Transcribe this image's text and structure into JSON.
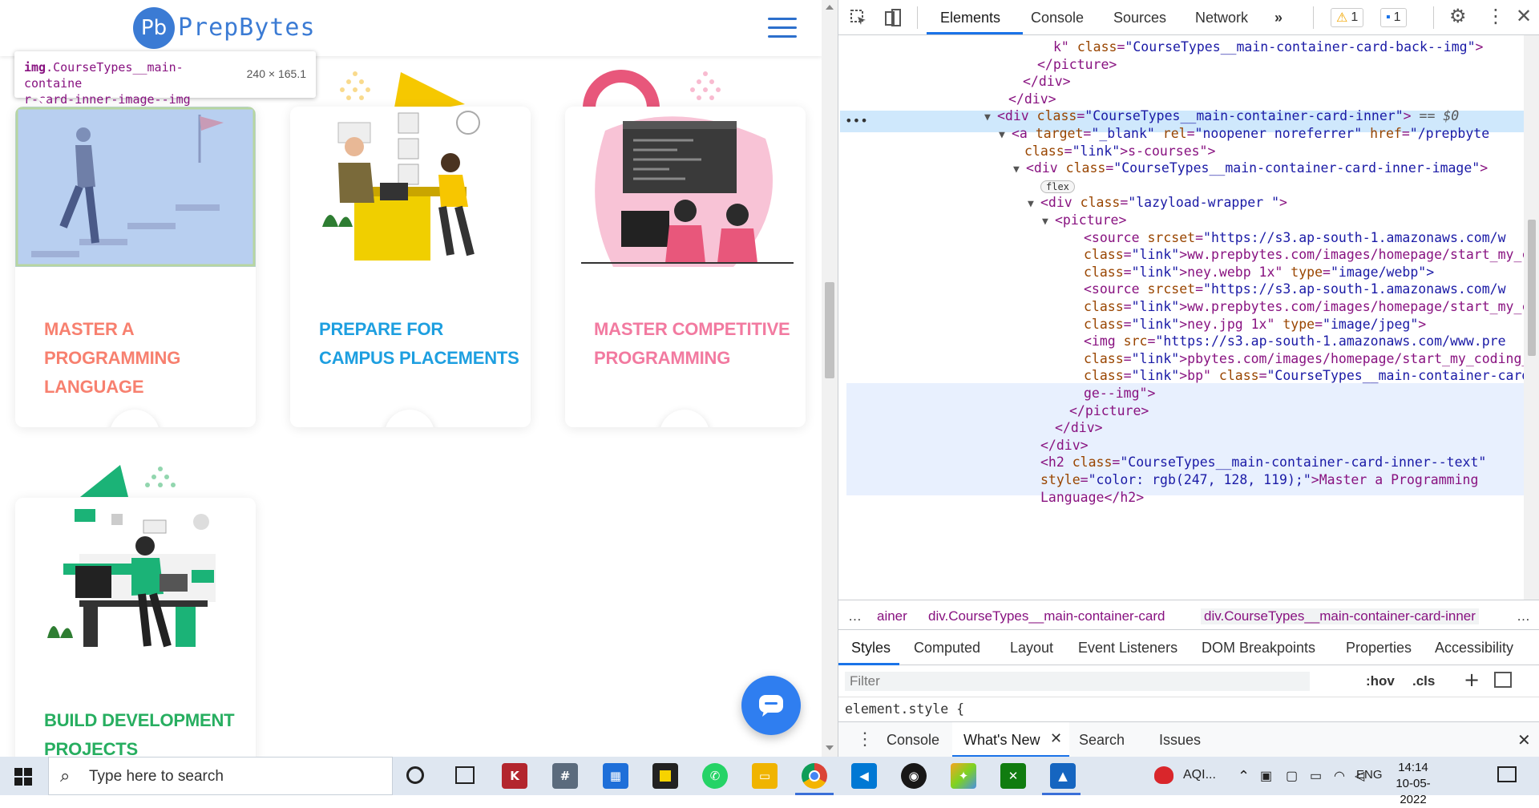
{
  "site": {
    "logo_mark": "Pb",
    "logo_text": "PrepBytes",
    "cards": [
      {
        "title": "MASTER A PROGRAMMING LANGUAGE",
        "color": "#f7806f"
      },
      {
        "title": "PREPARE FOR CAMPUS PLACEMENTS",
        "color": "#1e9fe0"
      },
      {
        "title": "MASTER COMPETITIVE PROGRAMMING",
        "color": "#f27aa0"
      },
      {
        "title": "BUILD DEVELOPMENT PROJECTS",
        "color": "#27ae60"
      }
    ],
    "arrow_glyph": "→"
  },
  "tooltip": {
    "element_tag": "img",
    "element_class_line1": ".CourseTypes__main-containe",
    "element_class_line2": "r-card-inner-image--img",
    "size": "240 × 165.1"
  },
  "devtools": {
    "tabs": [
      "Elements",
      "Console",
      "Sources",
      "Network"
    ],
    "more_tabs": "»",
    "warning_count": "1",
    "message_count": "1",
    "dom_lines": [
      {
        "indent": 268,
        "html": "k\" class=\"CourseTypes__main-container-card-back--img\">"
      },
      {
        "indent": 248,
        "html": "</picture>"
      },
      {
        "indent": 230,
        "html": "</div>"
      },
      {
        "indent": 212,
        "html": "</div>"
      },
      {
        "indent": 198,
        "html": "<div class=\"CourseTypes__main-container-card-inner\"> == $0"
      },
      {
        "indent": 216,
        "html": "<a target=\"_blank\" rel=\"noopener noreferrer\" href=\"/prepbyte"
      },
      {
        "indent": 232,
        "html": "s-courses\">"
      },
      {
        "indent": 234,
        "html": "<div class=\"CourseTypes__main-container-card-inner-image\">"
      },
      {
        "indent": 252,
        "html": "flex"
      },
      {
        "indent": 252,
        "html": "<div class=\"lazyload-wrapper \">"
      },
      {
        "indent": 270,
        "html": "<picture>"
      },
      {
        "indent": 306,
        "html": "<source srcset=\"https://s3.ap-south-1.amazonaws.com/w"
      },
      {
        "indent": 306,
        "html": "ww.prepbytes.com/images/homepage/start_my_coding_jour"
      },
      {
        "indent": 306,
        "html": "ney.webp 1x\" type=\"image/webp\">"
      },
      {
        "indent": 306,
        "html": "<source srcset=\"https://s3.ap-south-1.amazonaws.com/w"
      },
      {
        "indent": 306,
        "html": "ww.prepbytes.com/images/homepage/start_my_coding_jour"
      },
      {
        "indent": 306,
        "html": "ney.jpg 1x\" type=\"image/jpeg\">"
      },
      {
        "indent": 306,
        "html": "<img src=\"https://s3.ap-south-1.amazonaws.com/www.pre"
      },
      {
        "indent": 306,
        "html": "pbytes.com/images/homepage/start_my_coding_journey.we"
      },
      {
        "indent": 306,
        "html": "bp\" class=\"CourseTypes__main-container-card-inner-ima"
      },
      {
        "indent": 306,
        "html": "ge--img\">"
      },
      {
        "indent": 288,
        "html": "</picture>"
      },
      {
        "indent": 270,
        "html": "</div>"
      },
      {
        "indent": 252,
        "html": "</div>"
      },
      {
        "indent": 252,
        "html": "<h2 class=\"CourseTypes__main-container-card-inner--text\""
      },
      {
        "indent": 252,
        "html": "style=\"color: rgb(247, 128, 119);\">Master a Programming"
      },
      {
        "indent": 252,
        "html": "Language</h2>"
      }
    ],
    "breadcrumbs": [
      "…",
      "ainer",
      "div.CourseTypes__main-container-card",
      "div.CourseTypes__main-container-card-inner",
      "…"
    ],
    "styles_tabs": [
      "Styles",
      "Computed",
      "Layout",
      "Event Listeners",
      "DOM Breakpoints",
      "Properties",
      "Accessibility"
    ],
    "filter_placeholder": "Filter",
    "hov": ":hov",
    "cls": ".cls",
    "element_style": "element.style {",
    "drawer_tabs": [
      "Console",
      "What's New",
      "Search",
      "Issues"
    ]
  },
  "taskbar": {
    "search_placeholder": "Type here to search",
    "weather": "AQI...",
    "lang": "ENG",
    "time": "14:14",
    "date": "10-05-2022"
  }
}
